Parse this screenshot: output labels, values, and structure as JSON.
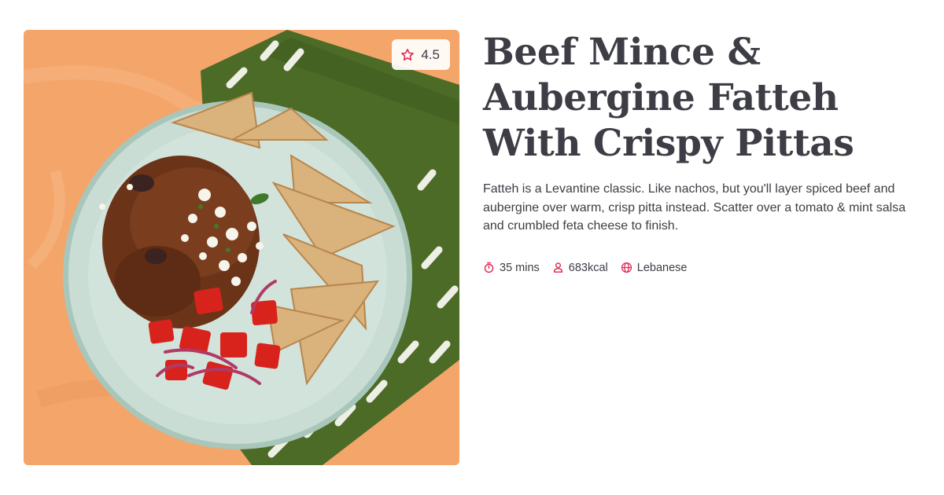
{
  "recipe": {
    "title": "Beef Mince & Aubergine Fatteh With Crispy Pittas",
    "description": "Fatteh is a Levantine classic. Like nachos, but you'll layer spiced beef and aubergine over warm, crisp pitta instead. Scatter over a tomato & mint salsa and crumbled feta cheese to finish.",
    "rating": "4.5",
    "rating_icon": "star-icon",
    "meta": {
      "time": "35 mins",
      "time_icon": "timer-icon",
      "calories": "683kcal",
      "calories_icon": "person-icon",
      "cuisine": "Lebanese",
      "cuisine_icon": "globe-icon"
    }
  },
  "colors": {
    "accent": "#e0234f",
    "text": "#3d3d45",
    "background": "#ffffff",
    "image_backdrop": "#f2a468",
    "napkin": "#4a6a26",
    "plate": "#c8ddd4"
  }
}
